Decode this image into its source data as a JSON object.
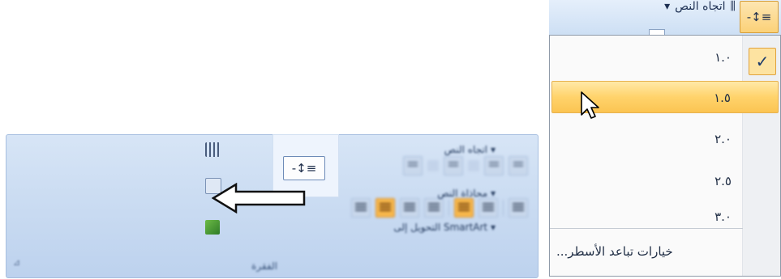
{
  "ribbon": {
    "group_name": "الفقرة",
    "text_direction": "اتجاه النص",
    "align_text": "محاذاة النص",
    "convert_smartart": "التحويل إلى SmartArt",
    "spacing_icon": "-↕≡",
    "dropdown_marker": "▾"
  },
  "menu": {
    "top_text_direction": "اتجاه النص",
    "items": [
      {
        "label": "١.٠",
        "checked": true
      },
      {
        "label": "١.٥",
        "hover": true
      },
      {
        "label": "٢.٠"
      },
      {
        "label": "٢.٥"
      },
      {
        "label": "٣.٠"
      }
    ],
    "check_mark": "✓",
    "options_label": "خيارات تباعد الأسطر..."
  },
  "colors": {
    "ribbon_blue": "#c8daf1",
    "highlight_orange": "#ffd36b",
    "menu_bg": "#fafafa"
  }
}
